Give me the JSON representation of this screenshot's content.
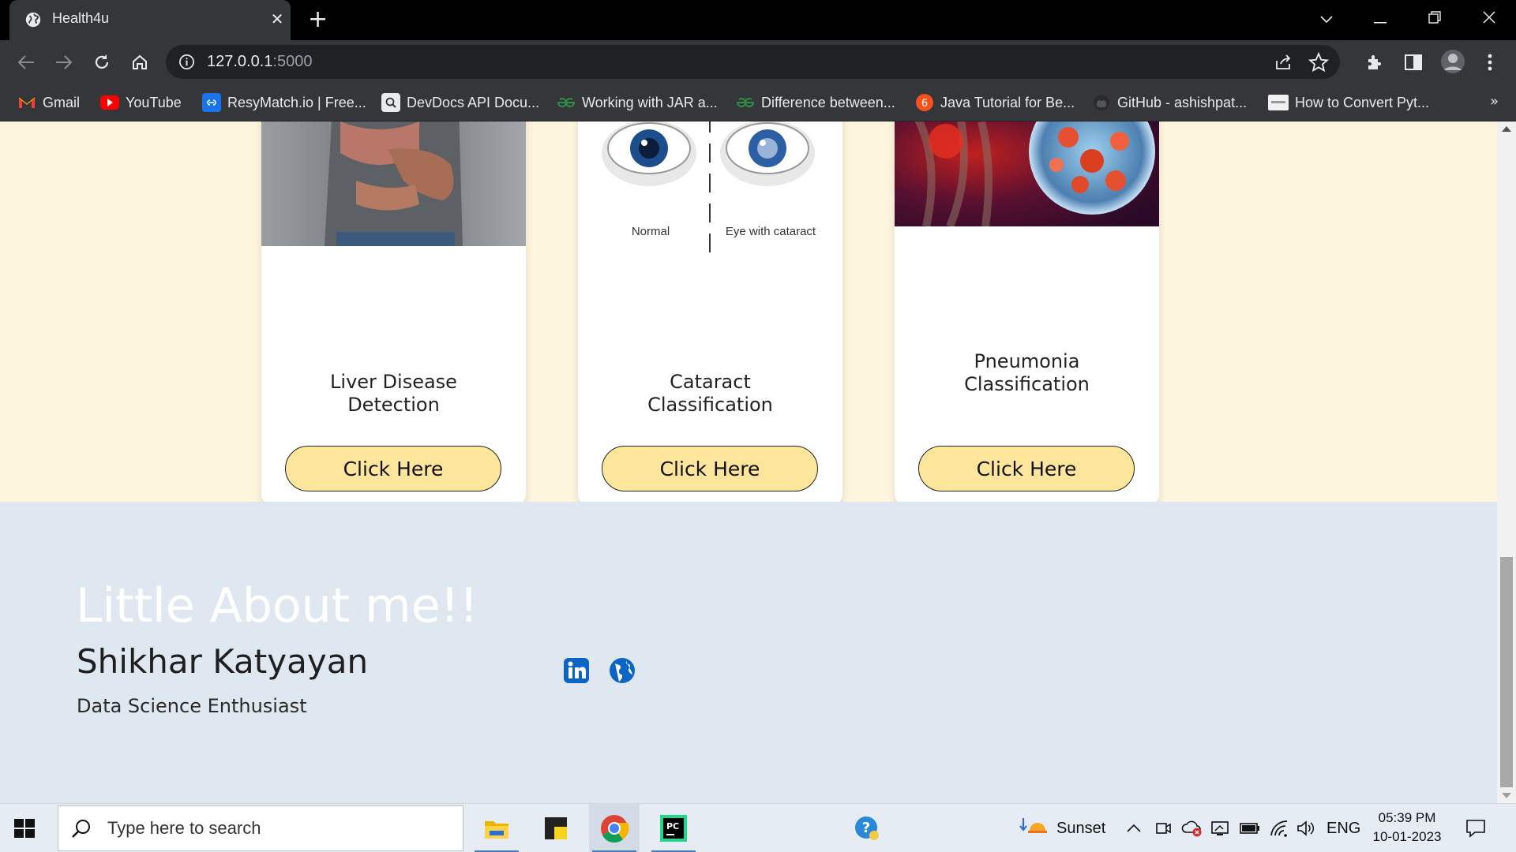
{
  "browser": {
    "tab_title": "Health4u",
    "url_host": "127.0.0.1",
    "url_port": ":5000",
    "bookmarks": [
      {
        "label": "Gmail",
        "icon": "gmail-icon"
      },
      {
        "label": "YouTube",
        "icon": "youtube-icon"
      },
      {
        "label": "ResyMatch.io | Free...",
        "icon": "resymatch-icon"
      },
      {
        "label": "DevDocs API Docu...",
        "icon": "devdocs-icon"
      },
      {
        "label": "Working with JAR a...",
        "icon": "geeksforgeeks-icon"
      },
      {
        "label": "Difference between...",
        "icon": "geeksforgeeks-icon"
      },
      {
        "label": "Java Tutorial for Be...",
        "icon": "java-tutorial-icon"
      },
      {
        "label": "GitHub - ashishpat...",
        "icon": "github-icon"
      },
      {
        "label": "How to Convert Pyt...",
        "icon": "appdoc-icon"
      }
    ],
    "more_bookmarks": "»"
  },
  "cards": [
    {
      "title_line1": "Liver Disease",
      "title_line2": "Detection",
      "button": "Click Here"
    },
    {
      "title_line1": "Cataract",
      "title_line2": "Classification",
      "button": "Click Here",
      "img_label_left": "Normal",
      "img_label_right": "Eye with cataract"
    },
    {
      "title_line1": "Pneumonia",
      "title_line2": "Classification",
      "button": "Click Here"
    }
  ],
  "about": {
    "heading": "Little About me!!",
    "name": "Shikhar Katyayan",
    "role": "Data Science Enthusiast",
    "social": [
      "linkedin-icon",
      "globe-icon"
    ]
  },
  "taskbar": {
    "search_placeholder": "Type here to search",
    "weather": "Sunset",
    "language": "ENG",
    "time": "05:39 PM",
    "date": "10-01-2023"
  },
  "colors": {
    "services_bg": "#fdf5de",
    "about_bg": "#dfe8f0",
    "button_bg": "#fde59b",
    "heading_white": "#ffffff"
  }
}
